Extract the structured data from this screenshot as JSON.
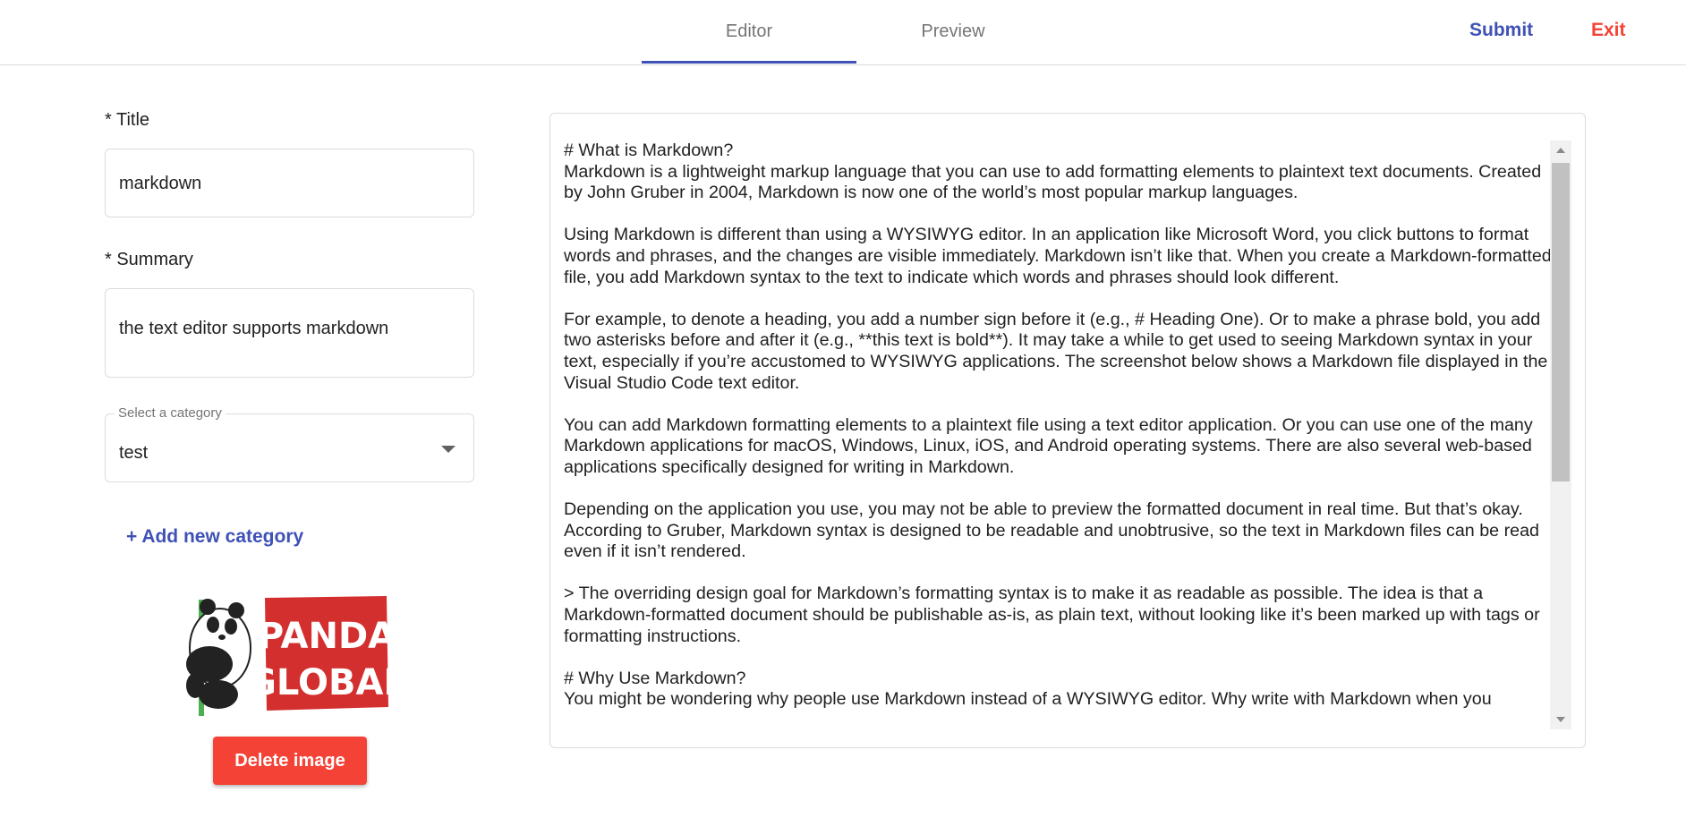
{
  "header": {
    "tabs": [
      {
        "label": "Editor",
        "active": true
      },
      {
        "label": "Preview",
        "active": false
      }
    ],
    "submit_label": "Submit",
    "exit_label": "Exit"
  },
  "form": {
    "title_label": "* Title",
    "title_value": "markdown",
    "summary_label": "* Summary",
    "summary_value": "the text editor supports markdown",
    "category_legend": "Select a category",
    "category_value": "test",
    "add_category_label": "+ Add new category",
    "image_logo_text": [
      "PANDA",
      "GLOBAL"
    ],
    "delete_image_label": "Delete image"
  },
  "editor": {
    "content": "# What is Markdown?\nMarkdown is a lightweight markup language that you can use to add formatting elements to plaintext text documents. Created by John Gruber in 2004, Markdown is now one of the world’s most popular markup languages.\n\nUsing Markdown is different than using a WYSIWYG editor. In an application like Microsoft Word, you click buttons to format words and phrases, and the changes are visible immediately. Markdown isn’t like that. When you create a Markdown-formatted file, you add Markdown syntax to the text to indicate which words and phrases should look different.\n\nFor example, to denote a heading, you add a number sign before it (e.g., # Heading One). Or to make a phrase bold, you add two asterisks before and after it (e.g., **this text is bold**). It may take a while to get used to seeing Markdown syntax in your text, especially if you’re accustomed to WYSIWYG applications. The screenshot below shows a Markdown file displayed in the Visual Studio Code text editor.\n\nYou can add Markdown formatting elements to a plaintext file using a text editor application. Or you can use one of the many Markdown applications for macOS, Windows, Linux, iOS, and Android operating systems. There are also several web-based applications specifically designed for writing in Markdown.\n\nDepending on the application you use, you may not be able to preview the formatted document in real time. But that’s okay. According to Gruber, Markdown syntax is designed to be readable and unobtrusive, so the text in Markdown files can be read even if it isn’t rendered.\n\n> The overriding design goal for Markdown’s formatting syntax is to make it as readable as possible. The idea is that a Markdown-formatted document should be publishable as-is, as plain text, without looking like it’s been marked up with tags or formatting instructions.\n\n# Why Use Markdown?\nYou might be wondering why people use Markdown instead of a WYSIWYG editor. Why write with Markdown when you"
  },
  "colors": {
    "accent": "#3f51b5",
    "danger": "#f44336",
    "logo_red": "#d32f2f",
    "bamboo_green": "#4caf50"
  }
}
